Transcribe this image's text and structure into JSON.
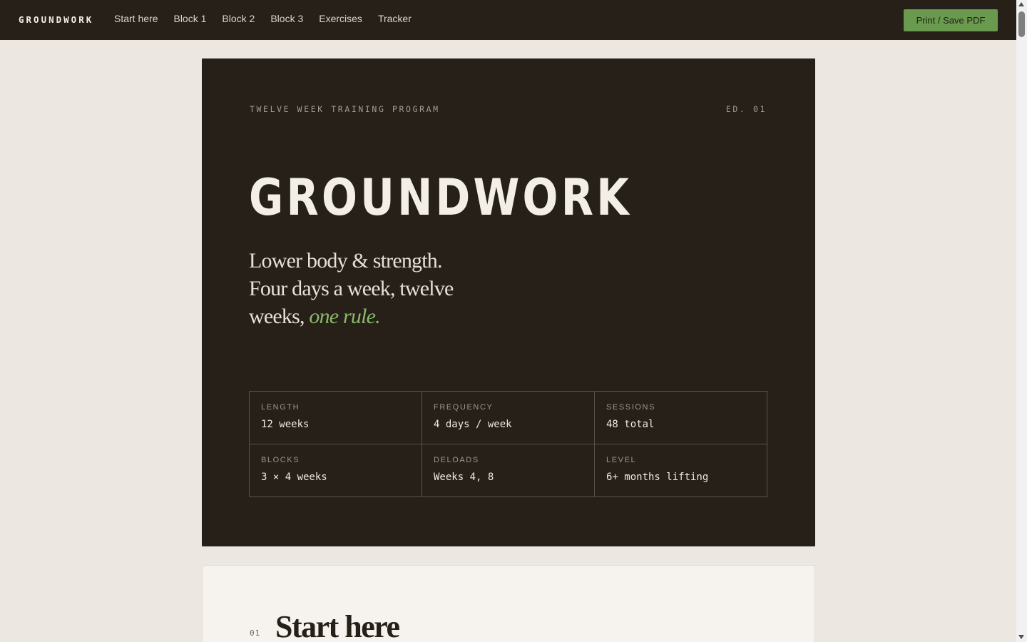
{
  "brand": "GROUNDWORK",
  "nav": {
    "links": [
      "Start here",
      "Block 1",
      "Block 2",
      "Block 3",
      "Exercises",
      "Tracker"
    ],
    "print_label": "Print / Save PDF"
  },
  "hero": {
    "eyebrow": "TWELVE WEEK TRAINING PROGRAM",
    "edition": "ED. 01",
    "title": "GROUNDWORK",
    "tagline_plain": "Lower body & strength. Four days a week, twelve weeks,",
    "tagline_accent": "one rule."
  },
  "stats": [
    {
      "label": "LENGTH",
      "value": "12 weeks"
    },
    {
      "label": "FREQUENCY",
      "value": "4 days / week"
    },
    {
      "label": "SESSIONS",
      "value": "48 total"
    },
    {
      "label": "BLOCKS",
      "value": "3 × 4 weeks"
    },
    {
      "label": "DELOADS",
      "value": "Weeks 4, 8"
    },
    {
      "label": "LEVEL",
      "value": "6+ months lifting"
    }
  ],
  "section": {
    "number": "01",
    "title": "Start here"
  },
  "colors": {
    "topbar_bg": "#262019",
    "page_bg": "#ece8e1",
    "accent_green": "#8ab96a",
    "button_green": "#6a9a4e"
  }
}
